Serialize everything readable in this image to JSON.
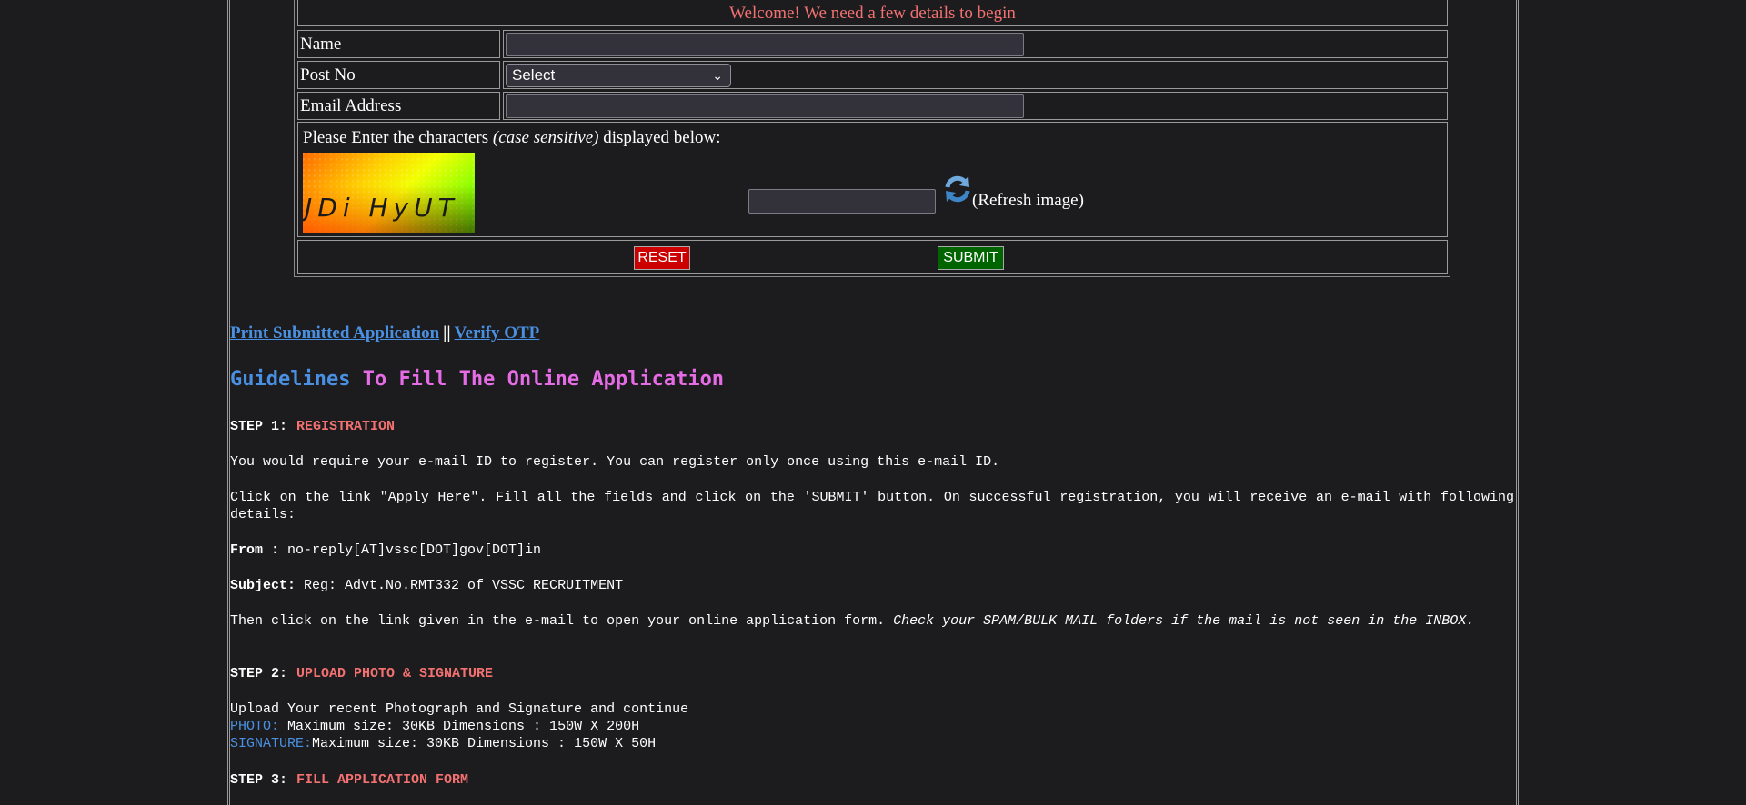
{
  "form": {
    "welcome": "Welcome! We need a few details to begin",
    "name_label": "Name",
    "post_label": "Post No",
    "post_selected": "Select",
    "email_label": "Email Address",
    "captcha_prompt_prefix": "Please Enter the characters ",
    "captcha_prompt_italic": "(case sensitive)",
    "captcha_prompt_suffix": " displayed below:",
    "captcha_text": "JDi HyUT",
    "refresh_label": "(Refresh image)",
    "reset_label": "RESET",
    "submit_label": "SUBMIT"
  },
  "links": {
    "print": "Print Submitted Application",
    "separator": "||",
    "verify": "Verify OTP"
  },
  "guidelines": {
    "heading_part1": "Guidelines",
    "heading_part2": "To Fill The Online Application",
    "step1_label": "STEP 1:",
    "step1_name": "REGISTRATION",
    "p1": "You would require your e-mail ID to register. You can register only once using this e-mail ID.",
    "p2": "Click on the link \"Apply Here\". Fill all the fields and click on the 'SUBMIT'  button. On successful registration, you will receive an e-mail with following details:",
    "from_label": "From :",
    "from_value": " no-reply[AT]vssc[DOT]gov[DOT]in",
    "subject_label": "Subject:",
    "subject_value": " Reg: Advt.No.RMT332 of VSSC RECRUITMENT",
    "p3_normal": "Then click on the link given in the e-mail to open your online application form. ",
    "p3_italic": "Check your SPAM/BULK MAIL folders if the mail is not seen in the INBOX.",
    "step2_label": "STEP 2:",
    "step2_name": "UPLOAD PHOTO & SIGNATURE",
    "p4": "Upload Your recent Photograph and Signature and continue",
    "photo_label": "PHOTO:",
    "photo_value": " Maximum size: 30KB Dimensions : 150W X 200H",
    "signature_label": "SIGNATURE:",
    "signature_value": "Maximum size: 30KB Dimensions : 150W X 50H",
    "step3_label": "STEP 3:",
    "step3_name": "FILL APPLICATION FORM"
  },
  "icons": {
    "refresh": "refresh-icon"
  },
  "colors": {
    "background": "#1c1c1e",
    "welcome": "#f47171",
    "link": "#4a90e2",
    "heading_pink": "#e66ce6",
    "reset": "#cc0000",
    "submit": "#006400"
  }
}
